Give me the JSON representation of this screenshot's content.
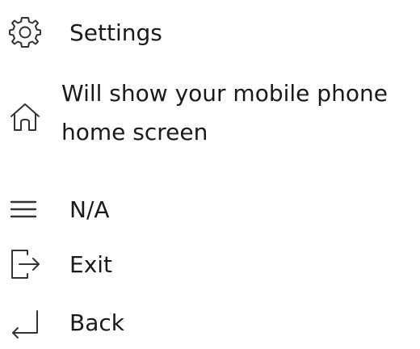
{
  "legend": {
    "items": [
      {
        "icon": "gear-icon",
        "label": "Settings"
      },
      {
        "icon": "home-icon",
        "label": "Will show your mobile phone home screen"
      },
      {
        "icon": "hamburger-menu-icon",
        "label": "N/A"
      },
      {
        "icon": "exit-icon",
        "label": "Exit"
      },
      {
        "icon": "back-icon",
        "label": "Back"
      }
    ]
  },
  "colors": {
    "text": "#1a1a1a",
    "icon_stroke": "#333333",
    "background": "#ffffff"
  }
}
